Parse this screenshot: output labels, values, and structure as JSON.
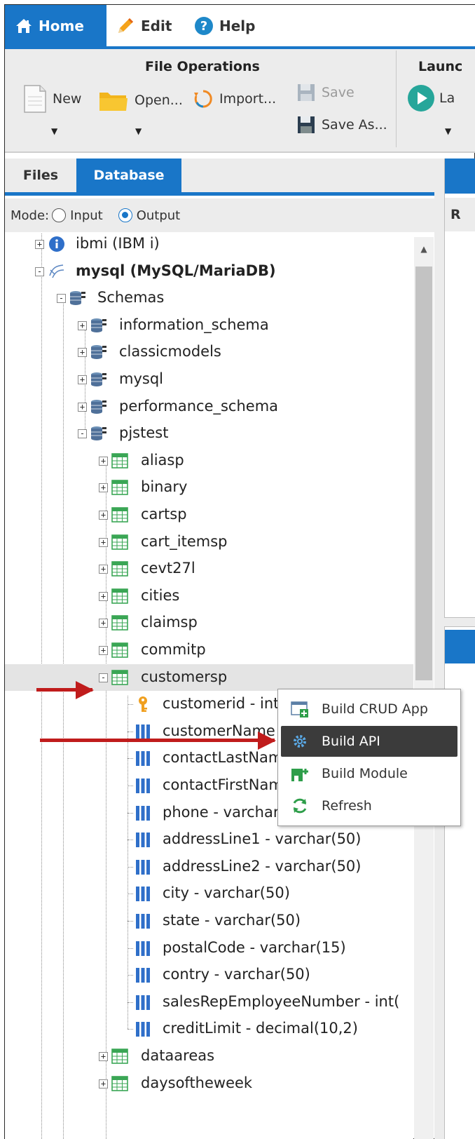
{
  "ribbon": {
    "tabs": [
      {
        "label": "Home",
        "icon": "home-icon",
        "active": true
      },
      {
        "label": "Edit",
        "icon": "pencil-icon"
      },
      {
        "label": "Help",
        "icon": "help-icon"
      }
    ],
    "groups": {
      "file_operations": {
        "title": "File Operations",
        "new": "New",
        "open": "Open...",
        "import": "Import...",
        "save": "Save",
        "save_as": "Save As..."
      },
      "launch": {
        "title": "Launc",
        "button": "La"
      }
    }
  },
  "panel": {
    "tabs": [
      {
        "label": "Files"
      },
      {
        "label": "Database",
        "active": true
      }
    ],
    "mode": {
      "label": "Mode:",
      "input": "Input",
      "output": "Output",
      "selected": "Output"
    }
  },
  "tree": [
    {
      "label": "ibmi (IBM i)",
      "icon": "info-db-icon"
    },
    {
      "label": "mysql (MySQL/MariaDB)",
      "icon": "connection-icon"
    },
    {
      "label": "Schemas",
      "icon": "schema-icon"
    },
    {
      "label": "information_schema",
      "icon": "schema-icon"
    },
    {
      "label": "classicmodels",
      "icon": "schema-icon"
    },
    {
      "label": "mysql",
      "icon": "schema-icon"
    },
    {
      "label": "performance_schema",
      "icon": "schema-icon"
    },
    {
      "label": "pjstest",
      "icon": "schema-icon"
    },
    {
      "label": "aliasp",
      "icon": "table-icon"
    },
    {
      "label": "binary",
      "icon": "table-icon"
    },
    {
      "label": "cartsp",
      "icon": "table-icon"
    },
    {
      "label": "cart_itemsp",
      "icon": "table-icon"
    },
    {
      "label": "cevt27l",
      "icon": "table-icon"
    },
    {
      "label": "cities",
      "icon": "table-icon"
    },
    {
      "label": "claimsp",
      "icon": "table-icon"
    },
    {
      "label": "commitp",
      "icon": "table-icon"
    },
    {
      "label": "customersp",
      "icon": "table-icon"
    },
    {
      "label": "customerid - int",
      "icon": "key-icon"
    },
    {
      "label": "customerName",
      "icon": "column-icon"
    },
    {
      "label": "contactLastName",
      "icon": "column-icon"
    },
    {
      "label": "contactFirstName",
      "icon": "column-icon"
    },
    {
      "label": "phone - varchar(50)",
      "icon": "column-icon"
    },
    {
      "label": "addressLine1 - varchar(50)",
      "icon": "column-icon"
    },
    {
      "label": "addressLine2 - varchar(50)",
      "icon": "column-icon"
    },
    {
      "label": "city - varchar(50)",
      "icon": "column-icon"
    },
    {
      "label": "state - varchar(50)",
      "icon": "column-icon"
    },
    {
      "label": "postalCode - varchar(15)",
      "icon": "column-icon"
    },
    {
      "label": "contry - varchar(50)",
      "icon": "column-icon"
    },
    {
      "label": "salesRepEmployeeNumber - int(",
      "icon": "column-icon"
    },
    {
      "label": "creditLimit - decimal(10,2)",
      "icon": "column-icon"
    },
    {
      "label": "dataareas",
      "icon": "table-icon"
    },
    {
      "label": "daysoftheweek",
      "icon": "table-icon"
    }
  ],
  "right_pane": {
    "subheader": "R"
  },
  "context_menu": {
    "items": [
      {
        "label": "Build CRUD App",
        "icon": "crud-app-icon"
      },
      {
        "label": "Build API",
        "icon": "gear-icon",
        "highlighted": true
      },
      {
        "label": "Build Module",
        "icon": "module-icon"
      },
      {
        "label": "Refresh",
        "icon": "refresh-icon"
      }
    ]
  },
  "colors": {
    "accent": "#1976c8",
    "annotation_arrow": "#c01c1c",
    "menu_highlight": "#3b3b3b"
  }
}
